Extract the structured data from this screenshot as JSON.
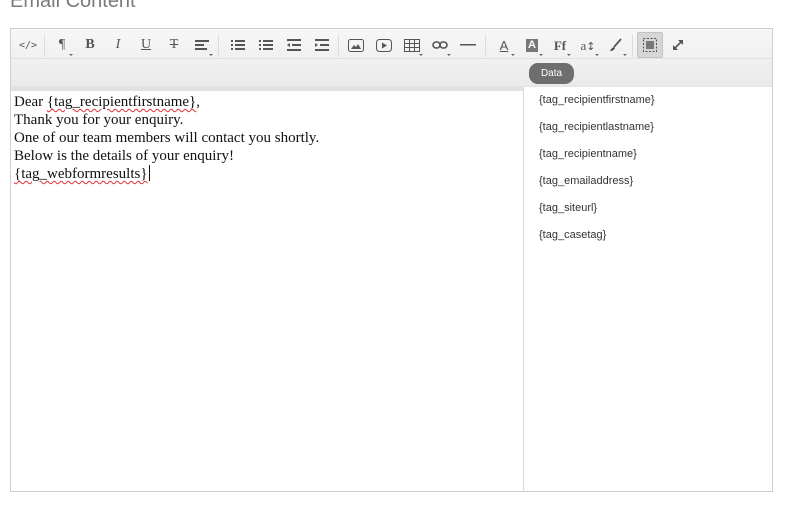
{
  "section": {
    "title": "Email Content"
  },
  "toolbar": {
    "buttons": [
      {
        "name": "html-source-button",
        "icon": "code-icon",
        "label": "</>"
      },
      {
        "name": "paragraph-format-button",
        "icon": "pilcrow-icon",
        "label": "¶"
      },
      {
        "name": "bold-button",
        "icon": "bold-icon",
        "label": "B"
      },
      {
        "name": "italic-button",
        "icon": "italic-icon",
        "label": "I"
      },
      {
        "name": "underline-button",
        "icon": "underline-icon",
        "label": "U"
      },
      {
        "name": "strikethrough-button",
        "icon": "strikethrough-icon",
        "label": "T"
      },
      {
        "name": "align-button",
        "icon": "align-left-icon"
      },
      {
        "name": "bullet-list-button",
        "icon": "bullet-list-icon"
      },
      {
        "name": "numbered-list-button",
        "icon": "numbered-list-icon"
      },
      {
        "name": "outdent-button",
        "icon": "outdent-icon"
      },
      {
        "name": "indent-button",
        "icon": "indent-icon"
      },
      {
        "name": "insert-image-button",
        "icon": "image-icon"
      },
      {
        "name": "insert-video-button",
        "icon": "video-icon"
      },
      {
        "name": "insert-table-button",
        "icon": "table-icon"
      },
      {
        "name": "insert-link-button",
        "icon": "link-icon"
      },
      {
        "name": "horizontal-rule-button",
        "icon": "horizontal-rule-icon"
      },
      {
        "name": "font-color-button",
        "icon": "font-color-icon",
        "label": "A"
      },
      {
        "name": "background-color-button",
        "icon": "background-color-icon",
        "label": "A"
      },
      {
        "name": "font-family-button",
        "icon": "font-family-icon",
        "label": "Ff"
      },
      {
        "name": "font-size-button",
        "icon": "font-size-icon",
        "label": "a"
      },
      {
        "name": "clear-format-button",
        "icon": "brush-icon"
      },
      {
        "name": "show-blocks-button",
        "icon": "show-blocks-icon",
        "active": true
      },
      {
        "name": "fullscreen-button",
        "icon": "expand-icon"
      }
    ]
  },
  "editor": {
    "lines": [
      {
        "pre": "Dear ",
        "tag": "{tag_recipientfirstname}",
        "post": ","
      },
      {
        "text": ""
      },
      {
        "text": "Thank you for your enquiry."
      },
      {
        "text": "One of our team members will contact you shortly."
      },
      {
        "text": "Below is the details of your enquiry!"
      },
      {
        "text": ""
      },
      {
        "pre": "",
        "tag": "{tag_webformresults}",
        "post": "",
        "cursor": true
      }
    ]
  },
  "data_panel": {
    "tab_label": "Data",
    "tags": [
      "{tag_recipientfirstname}",
      "{tag_recipientlastname}",
      "{tag_recipientname}",
      "{tag_emailaddress}",
      "{tag_siteurl}",
      "{tag_casetag}"
    ]
  },
  "colors": {
    "toolbar_bg": "#eeeeee",
    "data_tab_bg": "#6e6e6e",
    "title_text": "#7a7a7a",
    "spellcheck_underline": "#dd3333"
  }
}
